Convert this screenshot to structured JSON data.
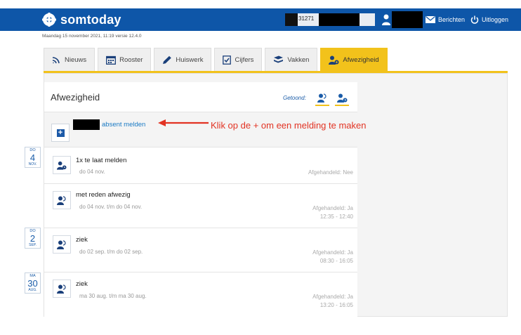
{
  "header": {
    "logo_text": "somtoday",
    "user_id_fragment": "31271",
    "nav": {
      "berichten": "Berichten",
      "uitloggen": "Uitloggen"
    }
  },
  "date_line": "Maandag 15 november 2021, 11:19 versie 12.4.0",
  "tabs": [
    {
      "label": "Nieuws",
      "icon": "signal-icon"
    },
    {
      "label": "Rooster",
      "icon": "calendar-icon"
    },
    {
      "label": "Huiswerk",
      "icon": "pencil-icon"
    },
    {
      "label": "Cijfers",
      "icon": "grade-check-icon"
    },
    {
      "label": "Vakken",
      "icon": "books-icon"
    },
    {
      "label": "Afwezigheid",
      "icon": "person-absent-icon",
      "active": true
    }
  ],
  "panel": {
    "title": "Afwezigheid",
    "shown_label": "Getoond:",
    "absent_link": "absent melden",
    "annotation": "Klik op de + om een melding te maken"
  },
  "items": [
    {
      "title": "1x te laat melden",
      "date": "do 04 nov.",
      "status": "Afgehandeld: Nee",
      "time": "",
      "day_badge": {
        "weekday": "DO",
        "day": "4",
        "month": "NOV."
      }
    },
    {
      "title": "met reden afwezig",
      "date": "do 04 nov. t/m do 04 nov.",
      "status": "Afgehandeld: Ja",
      "time": "12:35 - 12:40",
      "day_badge": null
    },
    {
      "title": "ziek",
      "date": "do 02 sep. t/m do 02 sep.",
      "status": "Afgehandeld: Ja",
      "time": "08:30 - 16:05",
      "day_badge": {
        "weekday": "DO",
        "day": "2",
        "month": "SEP."
      }
    },
    {
      "title": "ziek",
      "date": "ma 30 aug. t/m ma 30 aug.",
      "status": "Afgehandeld: Ja",
      "time": "13:20 - 16:05",
      "day_badge": {
        "weekday": "MA",
        "day": "30",
        "month": "AUG."
      }
    }
  ],
  "colors": {
    "brand_blue": "#0e56a8",
    "tab_active": "#f2c21b",
    "annotation_red": "#e23323",
    "link_blue": "#1a7ac4"
  }
}
